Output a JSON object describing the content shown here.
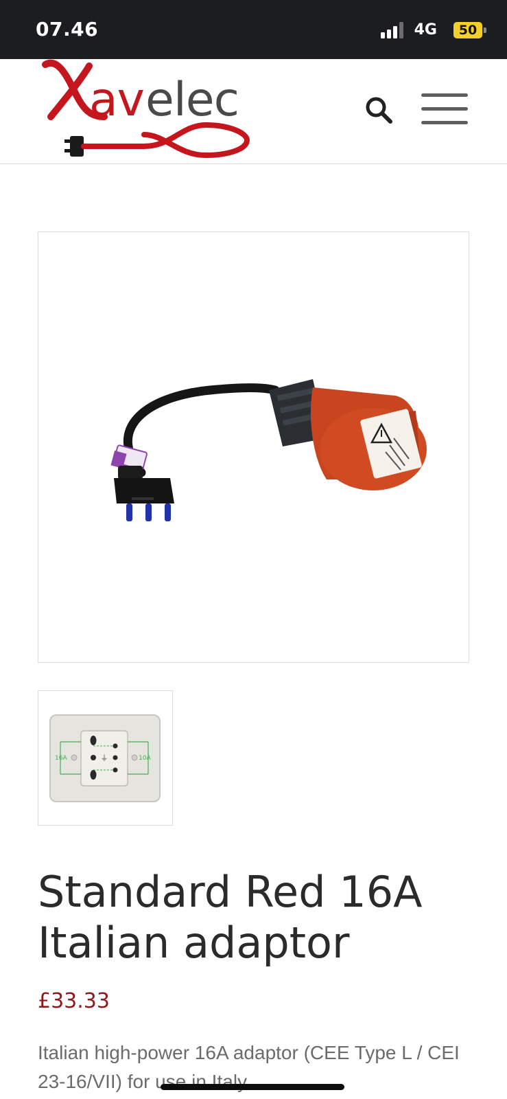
{
  "status_bar": {
    "time": "07.46",
    "network": "4G",
    "battery": "50",
    "battery_color": "#f5cf2c"
  },
  "header": {
    "logo_text": "Xavelec",
    "logo_colors": {
      "red": "#c4161c",
      "gray": "#4a4a4a"
    }
  },
  "gallery": {
    "main_image": "italian-adaptor-cable-photo",
    "thumbnail": "italian-socket-diagram",
    "thumbnail_labels": [
      "16A",
      "10A"
    ]
  },
  "product": {
    "title": "Standard Red 16A Italian adaptor",
    "price": "£33.33",
    "price_color": "#8b1a1a",
    "description": "Italian high-power 16A adaptor (CEE Type L / CEI 23-16/VII) for use in Italy."
  }
}
